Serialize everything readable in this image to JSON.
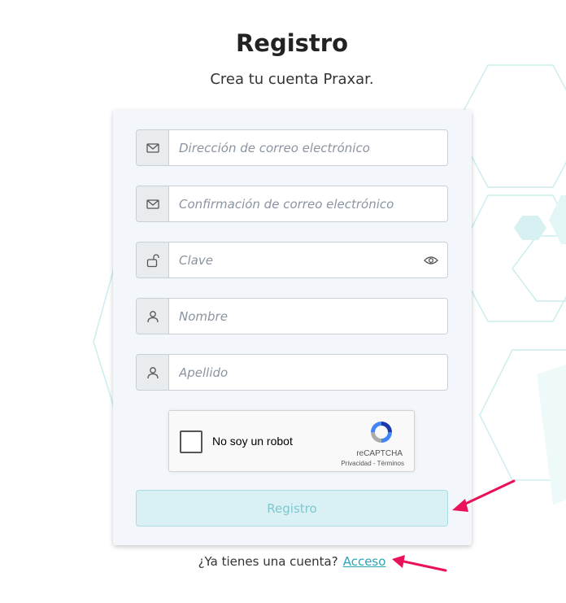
{
  "header": {
    "title": "Registro",
    "subtitle": "Crea tu cuenta Praxar."
  },
  "form": {
    "fields": [
      {
        "placeholder": "Dirección de correo electrónico",
        "icon": "envelope-icon",
        "value": ""
      },
      {
        "placeholder": "Confirmación de correo electrónico",
        "icon": "envelope-icon",
        "value": ""
      },
      {
        "placeholder": "Clave",
        "icon": "unlock-icon",
        "value": "",
        "trailing_icon": "eye-icon"
      },
      {
        "placeholder": "Nombre",
        "icon": "user-icon",
        "value": ""
      },
      {
        "placeholder": "Apellido",
        "icon": "user-icon",
        "value": ""
      }
    ],
    "captcha": {
      "label": "No soy un robot",
      "brand": "reCAPTCHA",
      "terms": "Privacidad - Términos"
    },
    "submit_label": "Registro"
  },
  "footer": {
    "question": "¿Ya tienes una cuenta?",
    "login_link": "Acceso"
  },
  "colors": {
    "accent": "#2aa5b6",
    "button_bg": "#d9f1f4",
    "annotation_arrow": "#e8115a"
  }
}
